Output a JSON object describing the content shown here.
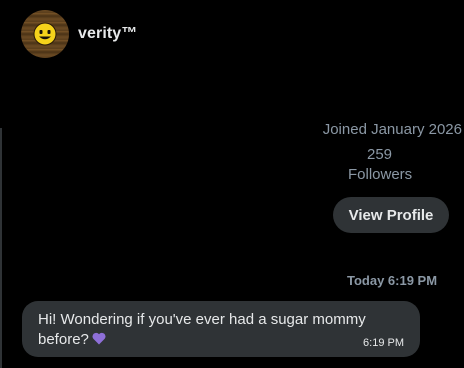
{
  "conversation": {
    "username": "verity™",
    "avatar_icon": "smiley-face-icon"
  },
  "profile": {
    "joined": "Joined January 2026",
    "followers_count": "259",
    "followers_label": "Followers",
    "view_profile_label": "View Profile"
  },
  "messages": {
    "day_stamp": "Today 6:19 PM",
    "items": [
      {
        "text": "Hi! Wondering if you've ever had a sugar mommy before?",
        "emoji": "purple-heart-icon",
        "time": "6:19 PM"
      }
    ]
  },
  "colors": {
    "background": "#000000",
    "bubble": "#2f3336",
    "muted_text": "#8b98a5",
    "heart": "#8e6fd8"
  }
}
